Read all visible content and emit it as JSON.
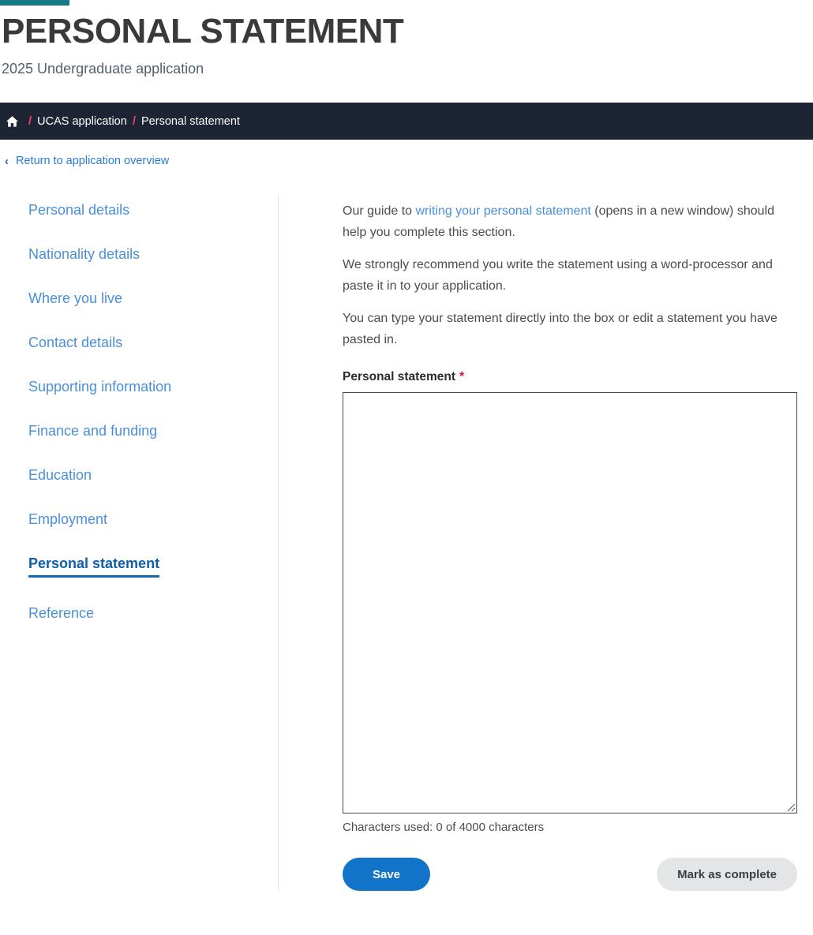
{
  "header": {
    "accent_color": "#137a86",
    "title": "PERSONAL STATEMENT",
    "subtitle": "2025 Undergraduate application"
  },
  "breadcrumb": {
    "home_icon": "home-icon",
    "separator": "/",
    "items": [
      {
        "label": "UCAS application",
        "current": false
      },
      {
        "label": "Personal statement",
        "current": true
      }
    ]
  },
  "return_link": {
    "chevron": "‹",
    "label": "Return to application overview"
  },
  "sidebar": {
    "items": [
      {
        "label": "Personal details",
        "active": false
      },
      {
        "label": "Nationality details",
        "active": false
      },
      {
        "label": "Where you live",
        "active": false
      },
      {
        "label": "Contact details",
        "active": false
      },
      {
        "label": "Supporting information",
        "active": false
      },
      {
        "label": "Finance and funding",
        "active": false
      },
      {
        "label": "Education",
        "active": false
      },
      {
        "label": "Employment",
        "active": false
      },
      {
        "label": "Personal statement",
        "active": true
      },
      {
        "label": "Reference",
        "active": false
      }
    ]
  },
  "main": {
    "paragraph1_before": "Our guide to ",
    "paragraph1_link": "writing your personal statement",
    "paragraph1_after": " (opens in a new window) should help you complete this section.",
    "paragraph2": "We strongly recommend you write the statement using a word-processor and paste it in to your application.",
    "paragraph3": "You can type your statement directly into the box or edit a statement you have pasted in.",
    "field_label": "Personal statement",
    "required_marker": "*",
    "statement_value": "",
    "statement_placeholder": "",
    "char_count": "Characters used: 0 of 4000 characters",
    "primary_button": "Save",
    "secondary_button": "Mark as complete"
  },
  "colors": {
    "accent_teal": "#137a86",
    "breadcrumb_bg": "#1d2433",
    "breadcrumb_separator": "#f0426b",
    "link_blue": "#4a90d9",
    "active_blue": "#0f5fa8",
    "required_red": "#d4183d",
    "primary_button": "#1274c8",
    "secondary_button": "#e4e5e6"
  }
}
